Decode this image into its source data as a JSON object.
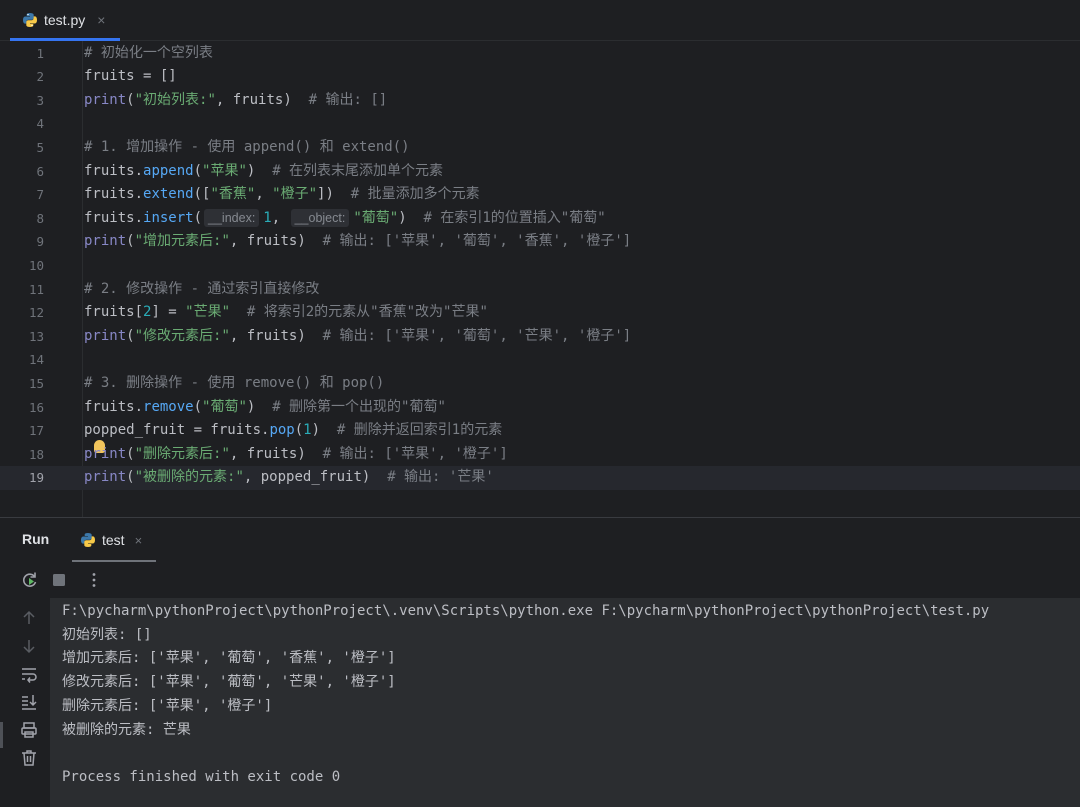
{
  "tab": {
    "filename": "test.py",
    "close": "×",
    "icon": "python-file-icon"
  },
  "editor": {
    "lines": [
      {
        "n": "1",
        "tokens": [
          {
            "t": "# 初始化一个空列表",
            "c": "cm"
          }
        ]
      },
      {
        "n": "2",
        "tokens": [
          {
            "t": "fruits = []",
            "c": ""
          }
        ]
      },
      {
        "n": "3",
        "tokens": [
          {
            "t": "print",
            "c": "bi"
          },
          {
            "t": "(",
            "c": ""
          },
          {
            "t": "\"初始列表:\"",
            "c": "str"
          },
          {
            "t": ", fruits)  ",
            "c": ""
          },
          {
            "t": "# 输出: []",
            "c": "cm"
          }
        ]
      },
      {
        "n": "4",
        "tokens": []
      },
      {
        "n": "5",
        "tokens": [
          {
            "t": "# 1. 增加操作 - 使用 append() 和 extend()",
            "c": "cm"
          }
        ]
      },
      {
        "n": "6",
        "tokens": [
          {
            "t": "fruits.",
            "c": ""
          },
          {
            "t": "append",
            "c": "fn"
          },
          {
            "t": "(",
            "c": ""
          },
          {
            "t": "\"苹果\"",
            "c": "str"
          },
          {
            "t": ")  ",
            "c": ""
          },
          {
            "t": "# 在列表末尾添加单个元素",
            "c": "cm"
          }
        ]
      },
      {
        "n": "7",
        "tokens": [
          {
            "t": "fruits.",
            "c": ""
          },
          {
            "t": "extend",
            "c": "fn"
          },
          {
            "t": "([",
            "c": ""
          },
          {
            "t": "\"香蕉\"",
            "c": "str"
          },
          {
            "t": ", ",
            "c": ""
          },
          {
            "t": "\"橙子\"",
            "c": "str"
          },
          {
            "t": "])  ",
            "c": ""
          },
          {
            "t": "# 批量添加多个元素",
            "c": "cm"
          }
        ]
      },
      {
        "n": "8",
        "tokens": [
          {
            "t": "fruits.",
            "c": ""
          },
          {
            "t": "insert",
            "c": "fn"
          },
          {
            "t": "(",
            "c": ""
          },
          {
            "t": "__index:",
            "c": "hint"
          },
          {
            "t": "1",
            "c": "num"
          },
          {
            "t": ", ",
            "c": ""
          },
          {
            "t": "__object:",
            "c": "hint"
          },
          {
            "t": "\"葡萄\"",
            "c": "str"
          },
          {
            "t": ")  ",
            "c": ""
          },
          {
            "t": "# 在索引1的位置插入\"葡萄\"",
            "c": "cm"
          }
        ]
      },
      {
        "n": "9",
        "tokens": [
          {
            "t": "print",
            "c": "bi"
          },
          {
            "t": "(",
            "c": ""
          },
          {
            "t": "\"增加元素后:\"",
            "c": "str"
          },
          {
            "t": ", fruits)  ",
            "c": ""
          },
          {
            "t": "# 输出: ['苹果', '葡萄', '香蕉', '橙子']",
            "c": "cm"
          }
        ]
      },
      {
        "n": "10",
        "tokens": []
      },
      {
        "n": "11",
        "tokens": [
          {
            "t": "# 2. 修改操作 - 通过索引直接修改",
            "c": "cm"
          }
        ]
      },
      {
        "n": "12",
        "tokens": [
          {
            "t": "fruits[",
            "c": ""
          },
          {
            "t": "2",
            "c": "num"
          },
          {
            "t": "] = ",
            "c": ""
          },
          {
            "t": "\"芒果\"",
            "c": "str"
          },
          {
            "t": "  ",
            "c": ""
          },
          {
            "t": "# 将索引2的元素从\"香蕉\"改为\"芒果\"",
            "c": "cm"
          }
        ]
      },
      {
        "n": "13",
        "tokens": [
          {
            "t": "print",
            "c": "bi"
          },
          {
            "t": "(",
            "c": ""
          },
          {
            "t": "\"修改元素后:\"",
            "c": "str"
          },
          {
            "t": ", fruits)  ",
            "c": ""
          },
          {
            "t": "# 输出: ['苹果', '葡萄', '芒果', '橙子']",
            "c": "cm"
          }
        ]
      },
      {
        "n": "14",
        "tokens": []
      },
      {
        "n": "15",
        "tokens": [
          {
            "t": "# 3. 删除操作 - 使用 remove() 和 pop()",
            "c": "cm"
          }
        ]
      },
      {
        "n": "16",
        "tokens": [
          {
            "t": "fruits.",
            "c": ""
          },
          {
            "t": "remove",
            "c": "fn"
          },
          {
            "t": "(",
            "c": ""
          },
          {
            "t": "\"葡萄\"",
            "c": "str"
          },
          {
            "t": ")  ",
            "c": ""
          },
          {
            "t": "# 删除第一个出现的\"葡萄\"",
            "c": "cm"
          }
        ]
      },
      {
        "n": "17",
        "tokens": [
          {
            "t": "popped_fruit = fruits.",
            "c": ""
          },
          {
            "t": "pop",
            "c": "fn"
          },
          {
            "t": "(",
            "c": ""
          },
          {
            "t": "1",
            "c": "num"
          },
          {
            "t": ")  ",
            "c": ""
          },
          {
            "t": "# 删除并返回索引1的元素",
            "c": "cm"
          }
        ]
      },
      {
        "n": "18",
        "tokens": [
          {
            "t": "print",
            "c": "bi"
          },
          {
            "t": "(",
            "c": ""
          },
          {
            "t": "\"删除元素后:\"",
            "c": "str"
          },
          {
            "t": ", fruits)  ",
            "c": ""
          },
          {
            "t": "# 输出: ['苹果', '橙子']",
            "c": "cm"
          }
        ]
      },
      {
        "n": "19",
        "tokens": [
          {
            "t": "print",
            "c": "bi"
          },
          {
            "t": "(",
            "c": ""
          },
          {
            "t": "\"被删除的元素:\"",
            "c": "str"
          },
          {
            "t": ", popped_fruit)  ",
            "c": ""
          },
          {
            "t": "# 输出: '芒果'",
            "c": "cm"
          }
        ]
      }
    ],
    "current_line": "19"
  },
  "run_panel": {
    "title": "Run",
    "tab_label": "test",
    "tab_close": "×",
    "toolbar_icons": [
      "rerun-icon",
      "stop-icon",
      "more-options-icon"
    ],
    "side_icons": [
      "scroll-up-icon",
      "scroll-down-icon",
      "soft-wrap-icon",
      "scroll-to-end-icon",
      "print-icon",
      "trash-icon"
    ]
  },
  "console": {
    "lines": [
      "F:\\pycharm\\pythonProject\\pythonProject\\.venv\\Scripts\\python.exe F:\\pycharm\\pythonProject\\pythonProject\\test.py",
      "初始列表: []",
      "增加元素后: ['苹果', '葡萄', '香蕉', '橙子']",
      "修改元素后: ['苹果', '葡萄', '芒果', '橙子']",
      "删除元素后: ['苹果', '橙子']",
      "被删除的元素: 芒果",
      "",
      "Process finished with exit code 0"
    ]
  },
  "colors": {
    "background": "#1e1f22",
    "accent": "#3574f0",
    "string": "#6aab73",
    "comment": "#7a7e85",
    "builtin": "#8888c6",
    "function": "#56a8f5",
    "number": "#2aacb8"
  }
}
